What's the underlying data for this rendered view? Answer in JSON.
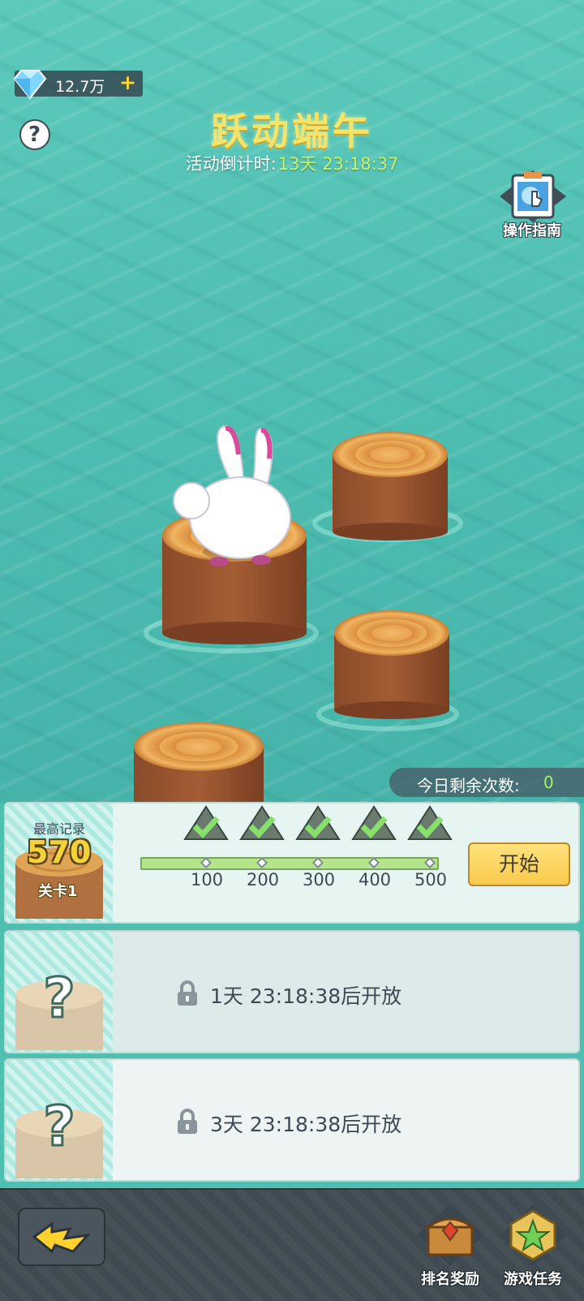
{
  "hud": {
    "currency_value": "12.7万",
    "currency_plus": "+",
    "help_symbol": "?"
  },
  "event": {
    "title": "跃动端午",
    "countdown_label": "活动倒计时:",
    "countdown_time": "13天 23:18:37"
  },
  "guide": {
    "label": "操作指南"
  },
  "remaining": {
    "label": "今日剩余次数:",
    "count": "0"
  },
  "level1": {
    "best_label": "最高记录",
    "best_score": "570",
    "stage": "关卡1",
    "milestones": [
      "100",
      "200",
      "300",
      "400",
      "500"
    ],
    "start_label": "开始"
  },
  "level2": {
    "unlock_text": "1天 23:18:38后开放"
  },
  "level3": {
    "unlock_text": "3天 23:18:38后开放"
  },
  "bottom": {
    "reward_label": "排名奖励",
    "task_label": "游戏任务"
  },
  "colors": {
    "water": "#4fbfb2",
    "title_gold": "#f5e46a",
    "countdown_green": "#c8f36a",
    "start_button": "#f9c94c"
  },
  "icons": {
    "gem": "diamond-icon",
    "help": "question-icon",
    "guide": "touch-guide-icon",
    "milestone": "rice-dumpling-check-icon",
    "lock": "padlock-icon",
    "back": "lightning-arrow-icon",
    "reward": "treasure-chest-icon",
    "task": "star-badge-icon"
  }
}
